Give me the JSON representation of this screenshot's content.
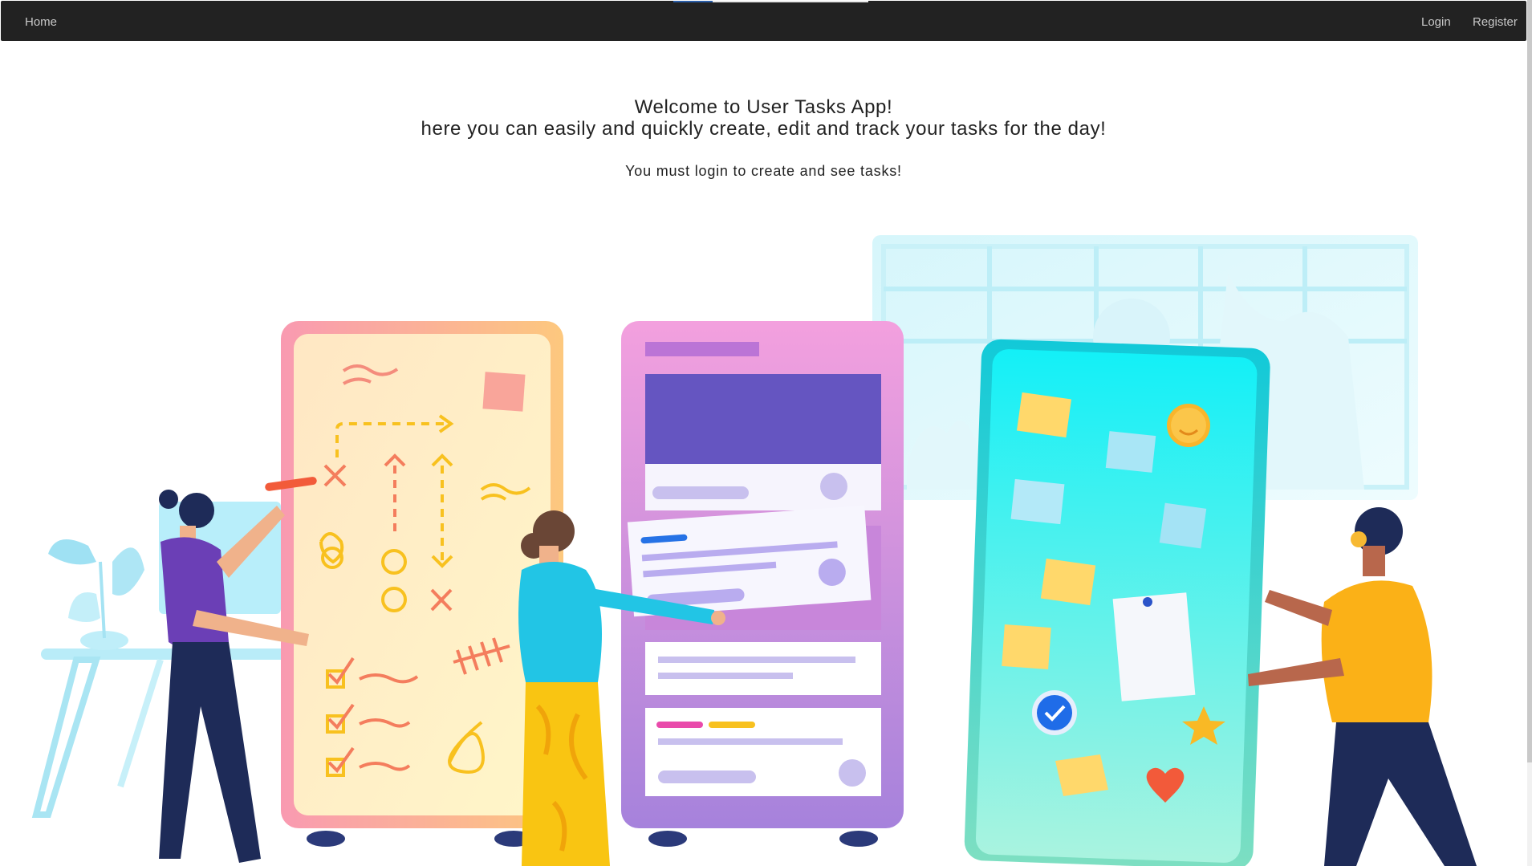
{
  "navbar": {
    "home_label": "Home",
    "login_label": "Login",
    "register_label": "Register",
    "load_progress": 0.2
  },
  "main": {
    "welcome_line1": "Welcome to User Tasks App!",
    "welcome_line2": "here you can easily and quickly create, edit and track your tasks for the day!",
    "login_notice": "You must login to create and see tasks!"
  },
  "illustration": {
    "subject": "team-task-boards",
    "colors": {
      "brainstorm_board": "#fdeac0",
      "kanban_board": "#e696d8",
      "kanban_header": "#6655c2",
      "sticky_board": "#5ef0f0",
      "note_yellow": "#ffd86b",
      "note_blue": "#9ddff7"
    }
  }
}
